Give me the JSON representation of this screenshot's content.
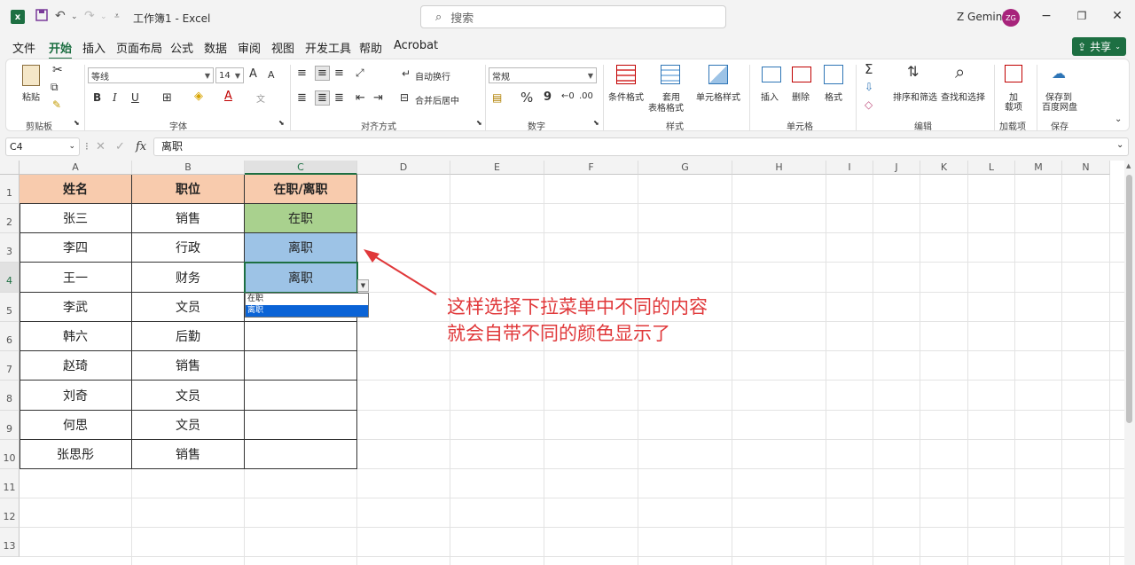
{
  "window": {
    "title": "工作簿1  -  Excel",
    "search_placeholder": "搜索",
    "user_name": "Z Gemini",
    "user_initials": "ZG"
  },
  "menu": {
    "items": [
      "文件",
      "开始",
      "插入",
      "页面布局",
      "公式",
      "数据",
      "审阅",
      "视图",
      "开发工具",
      "帮助",
      "Acrobat"
    ],
    "active": "开始",
    "share_label": "共享"
  },
  "ribbon": {
    "clipboard": {
      "paste": "粘贴",
      "group": "剪贴板"
    },
    "font": {
      "name": "等线",
      "size": "14",
      "grow": "A",
      "shrink": "A",
      "bold": "B",
      "italic": "I",
      "underline": "U",
      "group": "字体"
    },
    "alignment": {
      "wrap": "自动换行",
      "merge": "合并后居中",
      "group": "对齐方式"
    },
    "number": {
      "format": "常规",
      "percent": "%",
      "comma": "9",
      "group": "数字"
    },
    "styles": {
      "conditional": "条件格式",
      "table1": "套用",
      "table2": "表格格式",
      "cell_styles": "单元格样式",
      "group": "样式"
    },
    "cells": {
      "insert": "插入",
      "delete": "删除",
      "format": "格式",
      "group": "单元格"
    },
    "editing": {
      "sum": "Σ",
      "sort": "排序和筛选",
      "find": "查找和选择",
      "group": "编辑"
    },
    "addins": {
      "l1": "加",
      "l2": "载项",
      "group": "加载项"
    },
    "save": {
      "l1": "保存到",
      "l2": "百度网盘",
      "group": "保存"
    }
  },
  "formula_bar": {
    "name_box": "C4",
    "fx": "fx",
    "content": "离职"
  },
  "columns": [
    "A",
    "B",
    "C",
    "D",
    "E",
    "F",
    "G",
    "H",
    "I",
    "J",
    "K",
    "L",
    "M",
    "N"
  ],
  "rows": [
    "1",
    "2",
    "3",
    "4",
    "5",
    "6",
    "7",
    "8",
    "9",
    "10",
    "11",
    "12",
    "13"
  ],
  "table": {
    "headers": [
      "姓名",
      "职位",
      "在职/离职"
    ],
    "rows": [
      [
        "张三",
        "销售",
        "在职"
      ],
      [
        "李四",
        "行政",
        "离职"
      ],
      [
        "王一",
        "财务",
        "离职"
      ],
      [
        "李武",
        "文员",
        ""
      ],
      [
        "韩六",
        "后勤",
        ""
      ],
      [
        "赵琦",
        "销售",
        ""
      ],
      [
        "刘奇",
        "文员",
        ""
      ],
      [
        "何思",
        "文员",
        ""
      ],
      [
        "张思彤",
        "销售",
        ""
      ]
    ]
  },
  "dropdown": {
    "options": [
      "在职",
      "离职"
    ],
    "selected": "离职"
  },
  "annotation": {
    "line1": "这样选择下拉菜单中不同的内容",
    "line2": "就会自带不同的颜色显示了"
  },
  "colors": {
    "header_fill": "#f8cbad",
    "active_fill": "#a9d18e",
    "resigned_fill": "#9dc3e6",
    "annotation": "#e0383a",
    "excel_green": "#1d6f42"
  }
}
